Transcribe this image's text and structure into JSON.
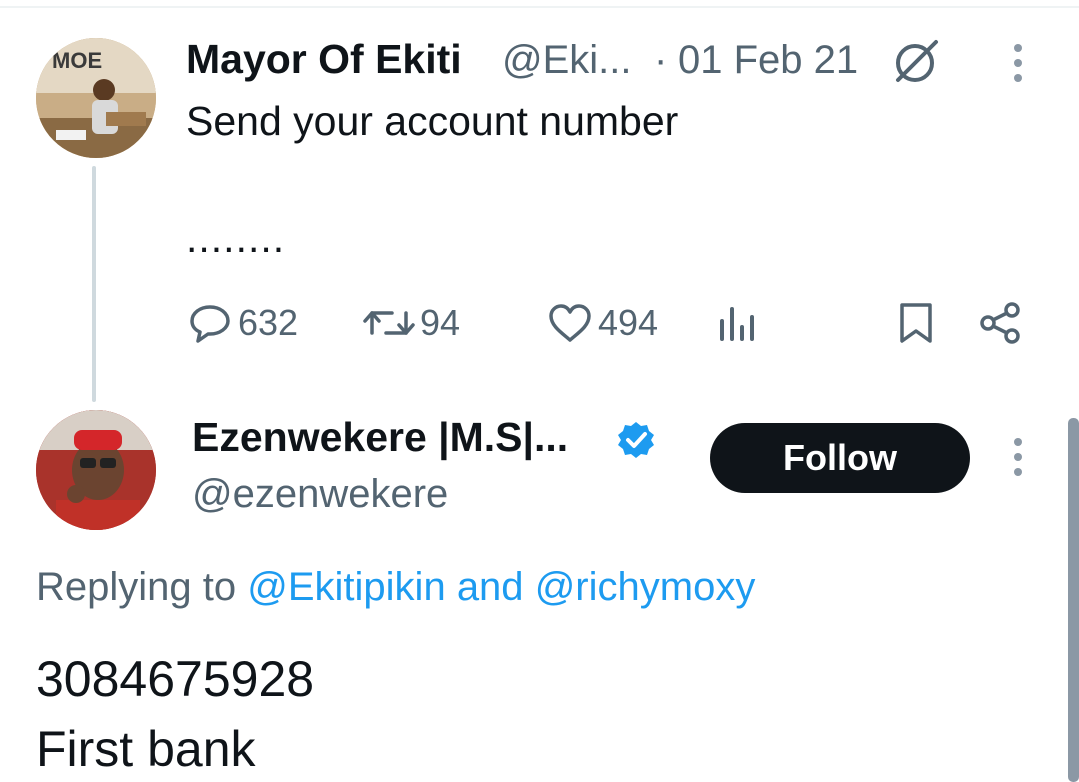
{
  "tweet1": {
    "display_name": "Mayor Of Ekiti",
    "handle": "@Eki...",
    "separator": "·",
    "date": "01 Feb 21",
    "text": "Send your account number",
    "ellipsis": "........",
    "avatar_logo": "MOE",
    "actions": {
      "replies": "632",
      "retweets": "94",
      "likes": "494"
    },
    "icons": [
      "grok-icon",
      "more-icon",
      "reply-icon",
      "retweet-icon",
      "like-icon",
      "views-icon",
      "bookmark-icon",
      "share-icon"
    ]
  },
  "tweet2": {
    "display_name": "Ezenwekere |M.S|...",
    "handle": "@ezenwekere",
    "verified": true,
    "follow_label": "Follow",
    "replying_prefix": "Replying to",
    "mention1": "@Ekitipikin",
    "conjunction": "and",
    "mention2": "@richymoxy",
    "body_line1": "3084675928",
    "body_line2": "First bank"
  },
  "colors": {
    "text_primary": "#0f1419",
    "text_secondary": "#536471",
    "link": "#1d9bf0",
    "verified_badge": "#1d9bf0",
    "follow_button_bg": "#0f1419",
    "thread_line": "#cfd9de"
  }
}
